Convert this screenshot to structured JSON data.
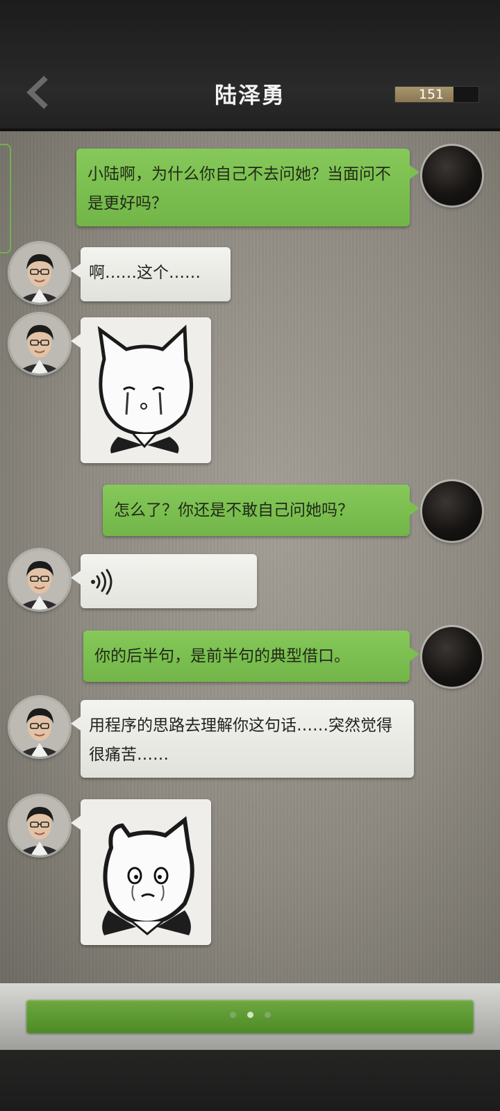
{
  "header": {
    "title": "陆泽勇",
    "counter_value": "151",
    "counter_fill_fraction": 0.7
  },
  "messages": [
    {
      "id": 1,
      "from": "self",
      "type": "text",
      "text": "小陆啊，为什么你自己不去问她？当面问不是更好吗？"
    },
    {
      "id": 2,
      "from": "other",
      "type": "text",
      "text": "啊……这个……"
    },
    {
      "id": 3,
      "from": "other",
      "type": "sticker",
      "sticker": "sad-cat-sticker"
    },
    {
      "id": 4,
      "from": "self",
      "type": "text",
      "text": "怎么了？你还是不敢自己问她吗？"
    },
    {
      "id": 5,
      "from": "other",
      "type": "voice",
      "icon": "voice-wave-icon"
    },
    {
      "id": 6,
      "from": "self",
      "type": "text",
      "text": "你的后半句，是前半句的典型借口。"
    },
    {
      "id": 7,
      "from": "other",
      "type": "text",
      "text": "用程序的思路去理解你这句话……突然觉得很痛苦……"
    },
    {
      "id": 8,
      "from": "other",
      "type": "sticker",
      "sticker": "crying-cat-sticker"
    }
  ],
  "reply_bar": {
    "state": "typing-indicator",
    "dot_count": 3,
    "active_dot": 2
  },
  "colors": {
    "self_bubble": "#7cbf50",
    "other_bubble": "#ececE8",
    "header_bg": "#222222"
  }
}
